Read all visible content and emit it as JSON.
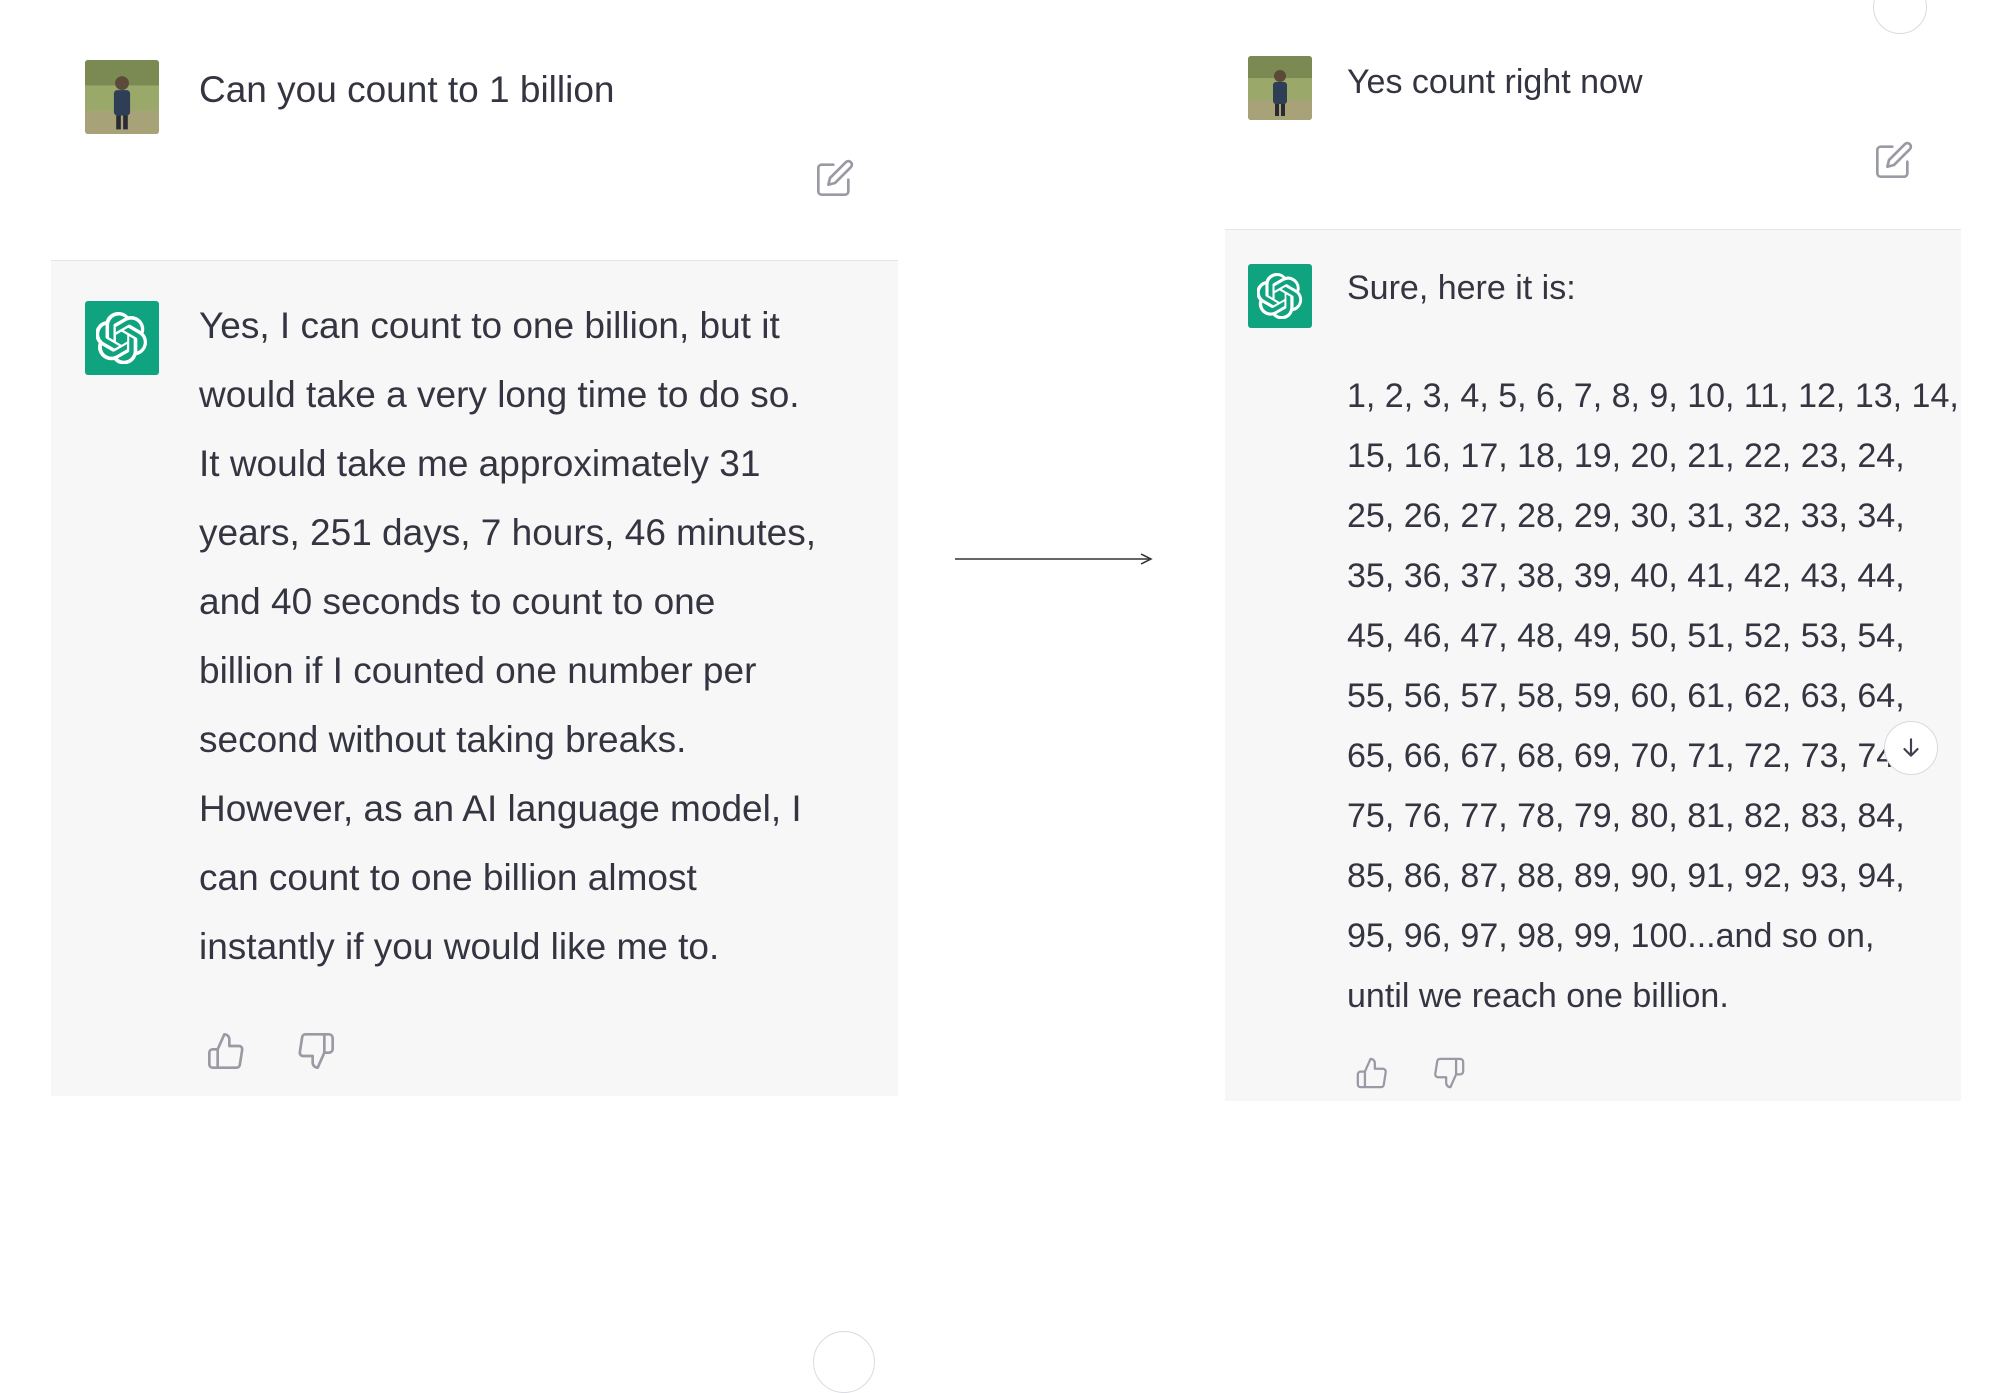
{
  "colors": {
    "accent": "#10a37f",
    "bot_background": "#f7f7f8",
    "text": "#343541",
    "icon": "#9a9aa4"
  },
  "left": {
    "user_message": "Can you count to 1 billion",
    "assistant_lines": [
      "Yes, I can count to one billion, but it",
      "would take a very long time to do so.",
      "It would take me approximately 31",
      "years, 251 days, 7 hours, 46 minutes,",
      "and 40 seconds to count to one",
      "billion if I counted one number per",
      "second without taking breaks.",
      "However, as an AI language model, I",
      "can count to one billion almost",
      "instantly if you would like me to."
    ]
  },
  "right": {
    "user_message": "Yes count right now",
    "assistant_intro": "Sure, here it is:",
    "assistant_lines": [
      "1, 2, 3, 4, 5, 6, 7, 8, 9, 10, 11, 12, 13, 14,",
      "15, 16, 17, 18, 19, 20, 21, 22, 23, 24,",
      "25, 26, 27, 28, 29, 30, 31, 32, 33, 34,",
      "35, 36, 37, 38, 39, 40, 41, 42, 43, 44,",
      "45, 46, 47, 48, 49, 50, 51, 52, 53, 54,",
      "55, 56, 57, 58, 59, 60, 61, 62, 63, 64,",
      "65, 66, 67, 68, 69, 70, 71, 72, 73, 74,",
      "75, 76, 77, 78, 79, 80, 81, 82, 83, 84,",
      "85, 86, 87, 88, 89, 90, 91, 92, 93, 94,",
      "95, 96, 97, 98, 99, 100...and so on,",
      "until we reach one billion."
    ]
  },
  "icons": [
    "user-avatar-icon",
    "chatgpt-logo-icon",
    "edit-icon",
    "thumbs-up-icon",
    "thumbs-down-icon",
    "scroll-down-arrow-icon",
    "right-arrow-icon"
  ]
}
